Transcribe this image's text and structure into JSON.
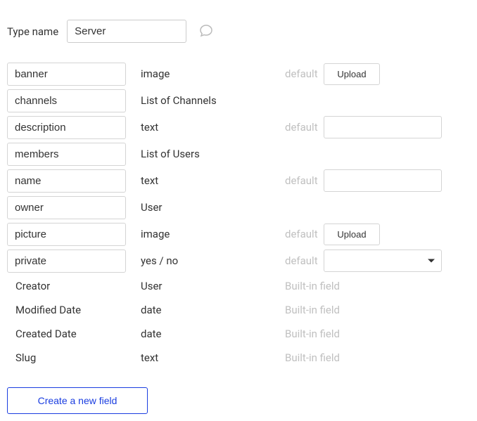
{
  "header": {
    "type_name_label": "Type name",
    "type_name_value": "Server"
  },
  "fields": {
    "editable": [
      {
        "name": "banner",
        "type": "image",
        "default_label": "default",
        "control": "upload",
        "upload_label": "Upload"
      },
      {
        "name": "channels",
        "type": "List of Channels",
        "default_label": "",
        "control": "none"
      },
      {
        "name": "description",
        "type": "text",
        "default_label": "default",
        "control": "text",
        "value": ""
      },
      {
        "name": "members",
        "type": "List of Users",
        "default_label": "",
        "control": "none"
      },
      {
        "name": "name",
        "type": "text",
        "default_label": "default",
        "control": "text",
        "value": ""
      },
      {
        "name": "owner",
        "type": "User",
        "default_label": "",
        "control": "none"
      },
      {
        "name": "picture",
        "type": "image",
        "default_label": "default",
        "control": "upload",
        "upload_label": "Upload"
      },
      {
        "name": "private",
        "type": "yes / no",
        "default_label": "default",
        "control": "select",
        "value": ""
      }
    ],
    "builtin": [
      {
        "name": "Creator",
        "type": "User",
        "label": "Built-in field"
      },
      {
        "name": "Modified Date",
        "type": "date",
        "label": "Built-in field"
      },
      {
        "name": "Created Date",
        "type": "date",
        "label": "Built-in field"
      },
      {
        "name": "Slug",
        "type": "text",
        "label": "Built-in field"
      }
    ]
  },
  "actions": {
    "create_field_label": "Create a new field"
  }
}
